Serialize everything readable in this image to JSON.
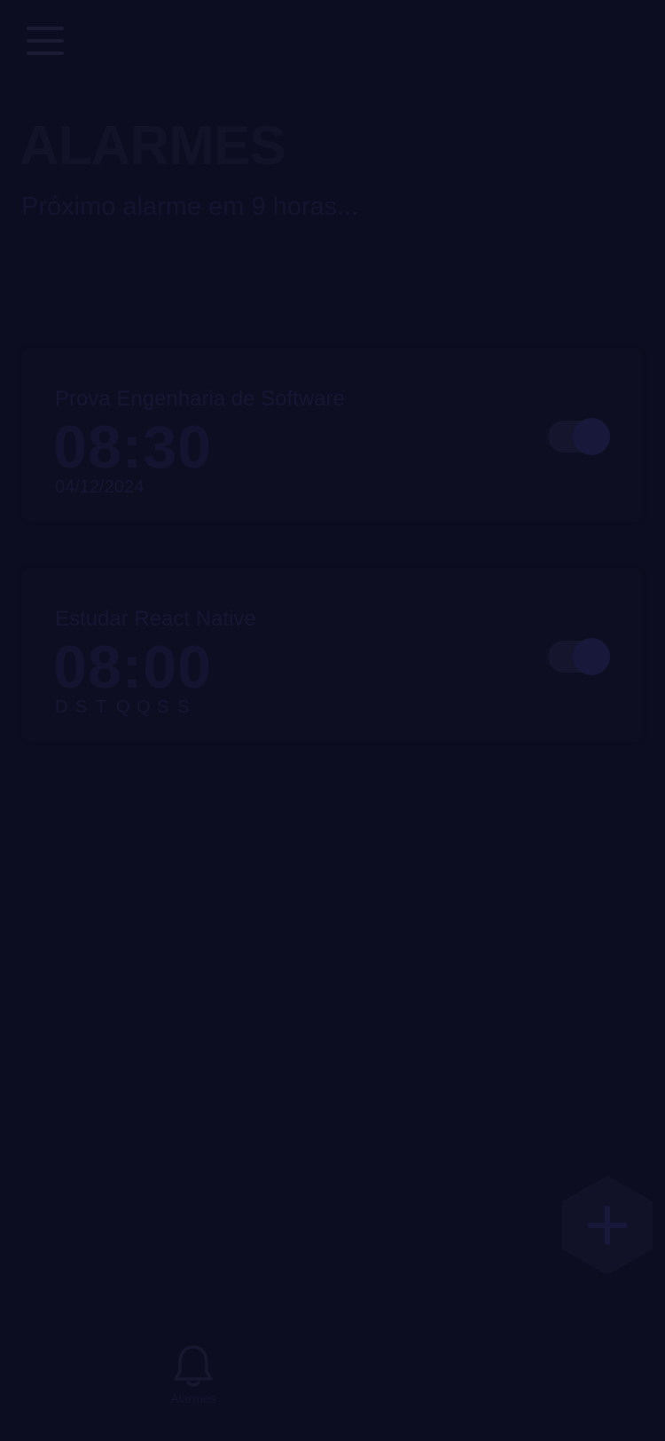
{
  "header": {
    "menu_icon": "hamburger-menu-icon",
    "title": "ALARMES",
    "subtitle": "Próximo alarme em 9 horas..."
  },
  "alarms": [
    {
      "name": "Prova Engenharia de Software",
      "time": "08:30",
      "date": "04/12/2024",
      "enabled": true
    },
    {
      "name": "Estudar React Native",
      "time": "08:00",
      "days": [
        "D",
        "S",
        "T",
        "Q",
        "Q",
        "S",
        "S"
      ],
      "enabled": true
    }
  ],
  "fab": {
    "icon": "plus-icon"
  },
  "bottom_nav": {
    "items": [
      {
        "label": "Alarmes",
        "icon": "bell-icon"
      }
    ]
  },
  "colors": {
    "background": "#0d0d21",
    "card": "#0e0e23",
    "text_dim": "#141430"
  }
}
